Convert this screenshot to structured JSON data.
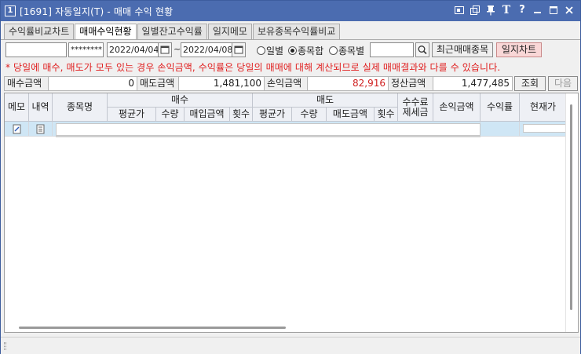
{
  "window": {
    "number": "1",
    "title": "[1691] 자동일지(T) - 매매 수익 현황",
    "buttons": [
      "restore-icon",
      "copy-icon",
      "pin-icon",
      "font-icon",
      "help-icon",
      "minimize-icon",
      "maximize-icon",
      "close-icon"
    ],
    "font_label": "T",
    "help_label": "?"
  },
  "tabs": [
    {
      "label": "수익률비교차트",
      "active": false
    },
    {
      "label": "매매수익현황",
      "active": true
    },
    {
      "label": "일별잔고수익률",
      "active": false
    },
    {
      "label": "일지메모",
      "active": false
    },
    {
      "label": "보유종목수익률비교",
      "active": false
    }
  ],
  "toolbar": {
    "account_value": "",
    "password_value": "********",
    "date_from": "2022/04/04",
    "date_sep": "~",
    "date_to": "2022/04/08",
    "radios": [
      {
        "label": "일별",
        "checked": false
      },
      {
        "label": "종목합",
        "checked": true
      },
      {
        "label": "종목별",
        "checked": false
      }
    ],
    "code_value": "",
    "recent_label": "최근매매종목",
    "chart_label": "일지차트"
  },
  "notice": "* 당일에 매수, 매도가 모두 있는 경우 손익금액, 수익률은 당일의 매매에 대해 계산되므로 실제 매매결과와 다를 수 있습니다.",
  "summary": {
    "buy_label": "매수금액",
    "buy_value": "0",
    "sell_label": "매도금액",
    "sell_value": "1,481,100",
    "pl_label": "손익금액",
    "pl_value": "82,916",
    "settle_label": "정산금액",
    "settle_value": "1,477,485",
    "query_label": "조회",
    "next_label": "다음"
  },
  "grid": {
    "headers": {
      "memo": "메모",
      "detail": "내역",
      "name": "종목명",
      "buy": "매수",
      "sell": "매도",
      "buy_avg": "평균가",
      "buy_qty": "수량",
      "buy_amt": "매입금액",
      "buy_cnt": "횟수",
      "sell_avg": "평균가",
      "sell_qty": "수량",
      "sell_amt": "매도금액",
      "sell_cnt": "횟수",
      "fee1": "수수료",
      "fee2": "제세금",
      "pl": "손익금액",
      "rate": "수익률",
      "current": "현재가"
    }
  },
  "colors": {
    "titlebar": "#4b6cb0",
    "notice": "#e02020",
    "profit": "#d02020",
    "selected_row": "#cfe6f5"
  }
}
